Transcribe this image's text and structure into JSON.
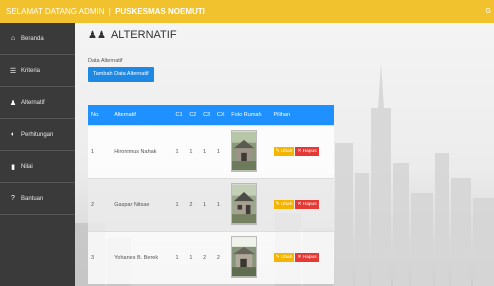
{
  "topbar": {
    "prefix": "SELAMAT DATANG ADMIN",
    "separator": "|",
    "brand": "PUSKESMAS NOEMUTI",
    "edge": "G"
  },
  "sidebar": {
    "items": [
      {
        "icon": "home-icon",
        "label": "Beranda"
      },
      {
        "icon": "list-icon",
        "label": "Kriteria"
      },
      {
        "icon": "users-icon",
        "label": "Alternatif"
      },
      {
        "icon": "pie-chart-icon",
        "label": "Perhitungan"
      },
      {
        "icon": "document-icon",
        "label": "Nilai"
      },
      {
        "icon": "help-icon",
        "label": "Bantuan"
      }
    ]
  },
  "page": {
    "title": "ALTERNATIF",
    "card_label": "Data Alternatif",
    "add_button": "Tambah Data Alternatif"
  },
  "table": {
    "headers": [
      "No.",
      "Alternatif",
      "C1",
      "C2",
      "C3",
      "CX",
      "Foto Rumah",
      "Pilihan"
    ],
    "rows": [
      {
        "no": "1",
        "name": "Hironimus Nahak",
        "c1": "1",
        "c2": "1",
        "c3": "1",
        "c4": "1"
      },
      {
        "no": "2",
        "name": "Gaspar Nitsae",
        "c1": "1",
        "c2": "2",
        "c3": "1",
        "c4": "1"
      },
      {
        "no": "3",
        "name": "Yohanes B. Berek",
        "c1": "1",
        "c2": "1",
        "c3": "2",
        "c4": "2"
      }
    ],
    "edit_label": "Ubah",
    "delete_label": "Hapus"
  },
  "colors": {
    "topbar": "#f2c12e",
    "sidebar": "#3a3a3a",
    "header": "#1e90ff",
    "edit": "#f4b400",
    "delete": "#e53935"
  }
}
